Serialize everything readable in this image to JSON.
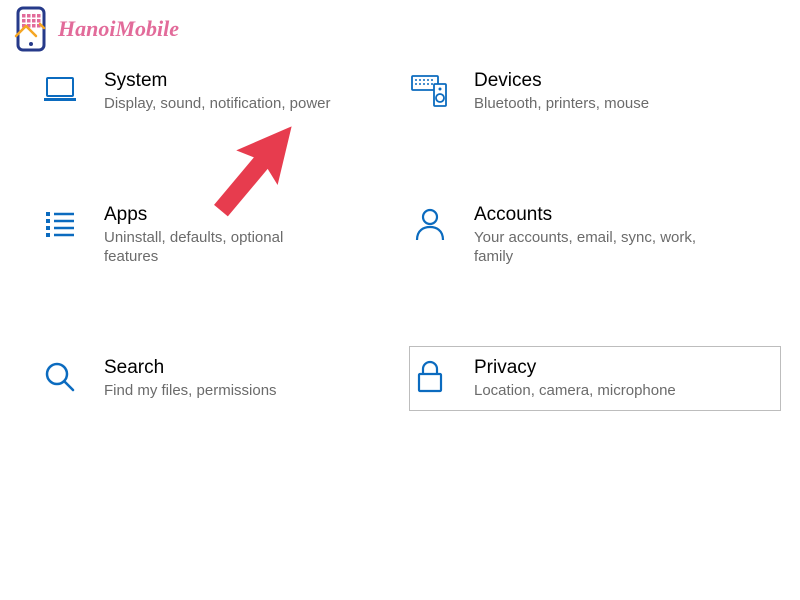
{
  "watermark": {
    "text": "HanoiMobile"
  },
  "colors": {
    "iconBlue": "#0b6bbf",
    "descGray": "#6b6b6b",
    "hoverBorder": "#bdbdbd",
    "arrowRed": "#e73c4e",
    "brandPink": "#e26b9a"
  },
  "tiles": [
    {
      "id": "system",
      "title": "System",
      "desc": "Display, sound, notification, power",
      "icon": "laptop-icon",
      "hovered": false
    },
    {
      "id": "devices",
      "title": "Devices",
      "desc": "Bluetooth, printers, mouse",
      "icon": "keyboard-speaker-icon",
      "hovered": false
    },
    {
      "id": "apps",
      "title": "Apps",
      "desc": "Uninstall, defaults, optional features",
      "icon": "apps-list-icon",
      "hovered": false
    },
    {
      "id": "accounts",
      "title": "Accounts",
      "desc": "Your accounts, email, sync, work, family",
      "icon": "person-icon",
      "hovered": false
    },
    {
      "id": "search",
      "title": "Search",
      "desc": "Find my files, permissions",
      "icon": "search-icon",
      "hovered": false
    },
    {
      "id": "privacy",
      "title": "Privacy",
      "desc": "Location, camera, microphone",
      "icon": "lock-icon",
      "hovered": true
    }
  ]
}
